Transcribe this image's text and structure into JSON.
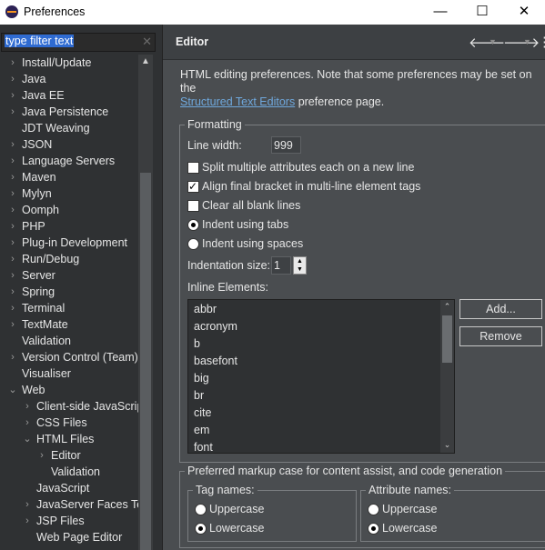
{
  "window": {
    "title": "Preferences"
  },
  "filter": {
    "text": "type filter text",
    "clear_icon": "✕"
  },
  "tree": {
    "items": [
      {
        "label": "Install/Update",
        "arrow": "›",
        "depth": 0
      },
      {
        "label": "Java",
        "arrow": "›",
        "depth": 0
      },
      {
        "label": "Java EE",
        "arrow": "›",
        "depth": 0
      },
      {
        "label": "Java Persistence",
        "arrow": "›",
        "depth": 0
      },
      {
        "label": "JDT Weaving",
        "arrow": "",
        "depth": 0
      },
      {
        "label": "JSON",
        "arrow": "›",
        "depth": 0
      },
      {
        "label": "Language Servers",
        "arrow": "›",
        "depth": 0
      },
      {
        "label": "Maven",
        "arrow": "›",
        "depth": 0
      },
      {
        "label": "Mylyn",
        "arrow": "›",
        "depth": 0
      },
      {
        "label": "Oomph",
        "arrow": "›",
        "depth": 0
      },
      {
        "label": "PHP",
        "arrow": "›",
        "depth": 0
      },
      {
        "label": "Plug-in Development",
        "arrow": "›",
        "depth": 0
      },
      {
        "label": "Run/Debug",
        "arrow": "›",
        "depth": 0
      },
      {
        "label": "Server",
        "arrow": "›",
        "depth": 0
      },
      {
        "label": "Spring",
        "arrow": "›",
        "depth": 0
      },
      {
        "label": "Terminal",
        "arrow": "›",
        "depth": 0
      },
      {
        "label": "TextMate",
        "arrow": "›",
        "depth": 0
      },
      {
        "label": "Validation",
        "arrow": "",
        "depth": 0
      },
      {
        "label": "Version Control (Team)",
        "arrow": "›",
        "depth": 0
      },
      {
        "label": "Visualiser",
        "arrow": "",
        "depth": 0
      },
      {
        "label": "Web",
        "arrow": "⌄",
        "depth": 0
      },
      {
        "label": "Client-side JavaScript",
        "arrow": "›",
        "depth": 1
      },
      {
        "label": "CSS Files",
        "arrow": "›",
        "depth": 1
      },
      {
        "label": "HTML Files",
        "arrow": "⌄",
        "depth": 1
      },
      {
        "label": "Editor",
        "arrow": "›",
        "depth": 2
      },
      {
        "label": "Validation",
        "arrow": "",
        "depth": 2
      },
      {
        "label": "JavaScript",
        "arrow": "",
        "depth": 1
      },
      {
        "label": "JavaServer Faces Tools",
        "arrow": "›",
        "depth": 1
      },
      {
        "label": "JSP Files",
        "arrow": "›",
        "depth": 1
      },
      {
        "label": "Web Page Editor",
        "arrow": "",
        "depth": 1
      }
    ]
  },
  "editor": {
    "title": "Editor",
    "description_text": "HTML editing preferences.  Note that some preferences may be set on the",
    "description_link": "Structured Text Editors",
    "description_suffix": " preference page.",
    "formatting": {
      "legend": "Formatting",
      "line_width_label": "Line width:",
      "line_width_value": "999",
      "split_attributes": "Split multiple attributes each on a new line",
      "align_bracket": "Align final bracket in multi-line element tags",
      "clear_blank": "Clear all blank lines",
      "indent_tabs": "Indent using tabs",
      "indent_spaces": "Indent using spaces",
      "indentation_size_label": "Indentation size:",
      "indentation_size_value": "1",
      "inline_elements_label": "Inline Elements:",
      "inline_elements": [
        "abbr",
        "acronym",
        "b",
        "basefont",
        "big",
        "br",
        "cite",
        "em",
        "font"
      ],
      "add_button": "Add...",
      "remove_button": "Remove"
    },
    "markup_case": {
      "legend": "Preferred markup case for content assist, and code generation",
      "tag_names_legend": "Tag names:",
      "tag_upper": "Uppercase",
      "tag_lower": "Lowercase",
      "attr_names_legend": "Attribute names:",
      "attr_upper": "Uppercase",
      "attr_lower": "Lowercase"
    }
  }
}
